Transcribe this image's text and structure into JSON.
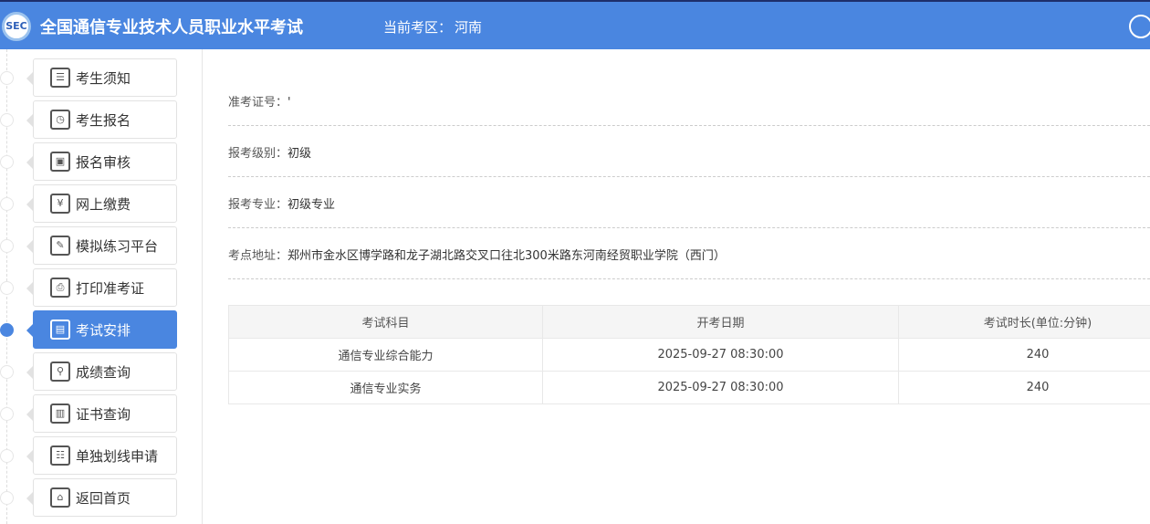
{
  "header": {
    "logo_text": "SEC",
    "title": "全国通信专业技术人员职业水平考试",
    "region_label": "当前考区：",
    "region": "河南"
  },
  "sidebar": {
    "items": [
      {
        "label": "考生须知",
        "icon": "notice-icon"
      },
      {
        "label": "考生报名",
        "icon": "clock-icon"
      },
      {
        "label": "报名审核",
        "icon": "review-icon"
      },
      {
        "label": "网上缴费",
        "icon": "payment-icon"
      },
      {
        "label": "模拟练习平台",
        "icon": "practice-icon"
      },
      {
        "label": "打印准考证",
        "icon": "printer-icon"
      },
      {
        "label": "考试安排",
        "icon": "document-icon",
        "active": true
      },
      {
        "label": "成绩查询",
        "icon": "search-icon"
      },
      {
        "label": "证书查询",
        "icon": "certificate-icon"
      },
      {
        "label": "单独划线申请",
        "icon": "application-icon"
      },
      {
        "label": "返回首页",
        "icon": "home-icon"
      }
    ]
  },
  "info": {
    "ticket_label": "准考证号：",
    "ticket_value": "'",
    "level_label": "报考级别：",
    "level_value": "初级",
    "major_label": "报考专业：",
    "major_value": "初级专业",
    "site_label": "考点地址：",
    "site_value": "郑州市金水区博学路和龙子湖北路交叉口往北300米路东河南经贸职业学院（西门）"
  },
  "table": {
    "headers": [
      "考试科目",
      "开考日期",
      "考试时长(单位:分钟)"
    ],
    "rows": [
      [
        "通信专业综合能力",
        "2025-09-27 08:30:00",
        "240"
      ],
      [
        "通信专业实务",
        "2025-09-27 08:30:00",
        "240"
      ]
    ]
  }
}
